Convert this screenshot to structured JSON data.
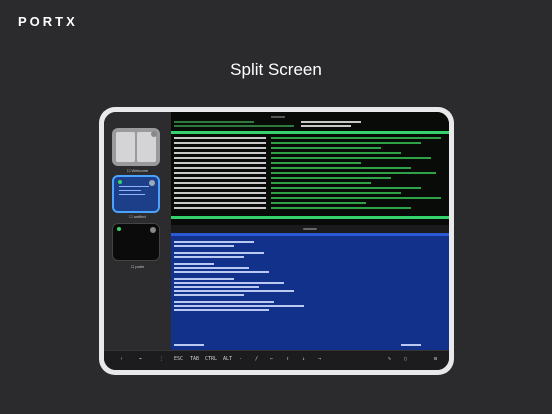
{
  "brand": {
    "logo": "PORTX"
  },
  "headline": "Split Screen",
  "sidebar": {
    "items": [
      {
        "label": "☐ Welcome"
      },
      {
        "label": "☐ unified"
      },
      {
        "label": "☐ portx"
      }
    ]
  },
  "keybar": {
    "keys": [
      "‹",
      "⌁",
      "⋮",
      "ESC",
      "TAB",
      "CTRL",
      "ALT",
      "-",
      "/",
      "←",
      "↑",
      "↓",
      "→",
      "✎",
      "▢",
      "⊟"
    ]
  },
  "colors": {
    "background": "#2b2b2d",
    "accent": "#4aa3ff",
    "terminal_blue": "#12318a",
    "terminal_black": "#090b09",
    "terminal_green": "#35d16a"
  }
}
